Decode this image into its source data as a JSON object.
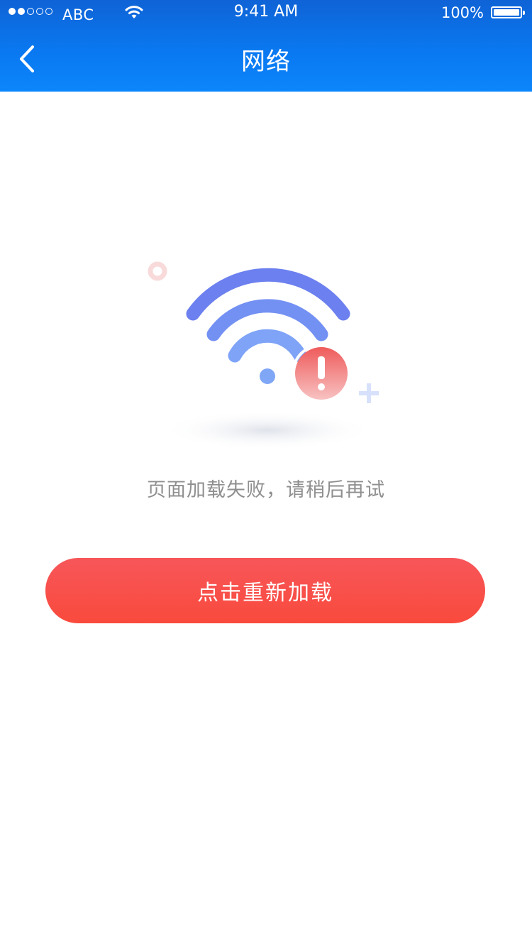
{
  "status_bar": {
    "carrier": "ABC",
    "time": "9:41 AM",
    "battery_percent": "100%",
    "signal_bars_filled": 2,
    "signal_bars_total": 5
  },
  "nav": {
    "title": "网络",
    "back_icon": "chevron-left-icon"
  },
  "content": {
    "illustration_icon": "wifi-error-icon",
    "error_message": "页面加载失败，请稍后再试",
    "reload_button_label": "点击重新加载"
  },
  "colors": {
    "header_blue": "#0a78f0",
    "button_red": "#f94a3c",
    "message_gray": "#8f8f8f",
    "wifi_blue": "#6f86f2",
    "alert_red": "#f06a6a"
  }
}
